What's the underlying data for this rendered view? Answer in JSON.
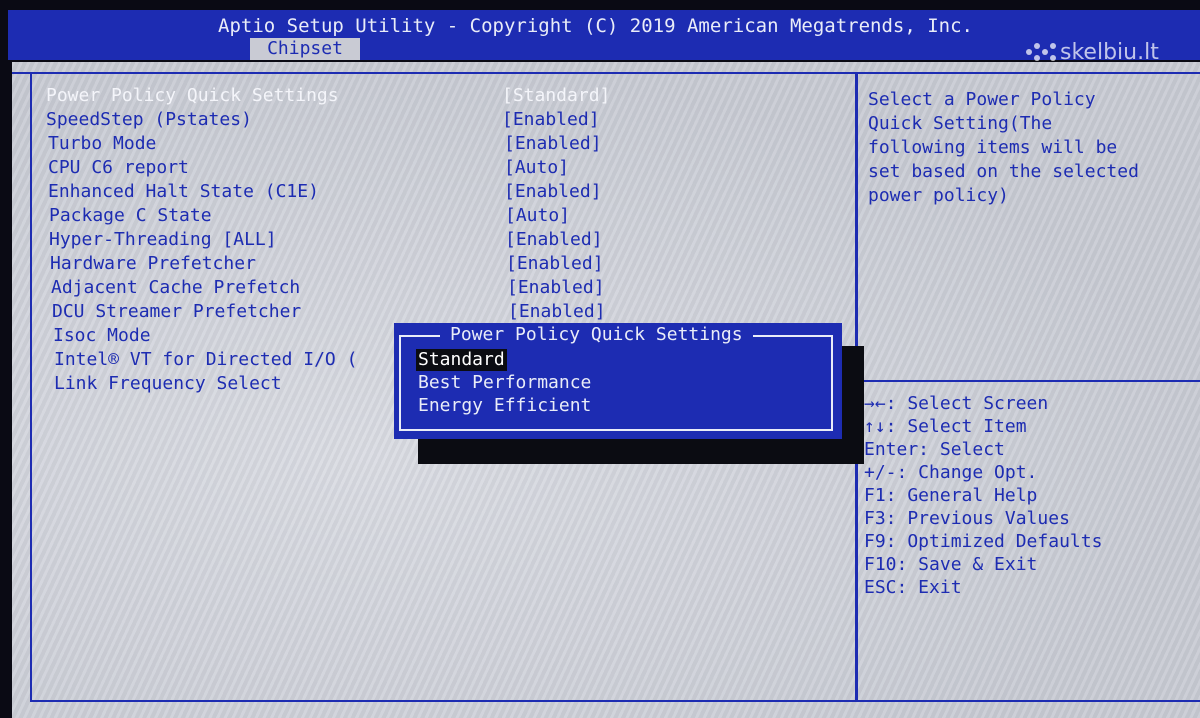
{
  "header": {
    "title": "Aptio Setup Utility - Copyright (C) 2019 American Megatrends, Inc.",
    "active_tab": "Chipset",
    "watermark": "skelbiu.lt"
  },
  "settings": [
    {
      "label": "Power Policy Quick Settings",
      "value": "[Standard]",
      "selected": true
    },
    {
      "label": "SpeedStep (Pstates)",
      "value": "[Enabled]"
    },
    {
      "label": "Turbo Mode",
      "value": "[Enabled]"
    },
    {
      "label": "CPU C6 report",
      "value": "[Auto]"
    },
    {
      "label": "Enhanced Halt State (C1E)",
      "value": "[Enabled]"
    },
    {
      "label": "Package C State",
      "value": "[Auto]"
    },
    {
      "label": "Hyper-Threading [ALL]",
      "value": "[Enabled]"
    },
    {
      "label": "Hardware Prefetcher",
      "value": "[Enabled]"
    },
    {
      "label": "Adjacent Cache Prefetch",
      "value": "[Enabled]"
    },
    {
      "label": "DCU Streamer Prefetcher",
      "value": "[Enabled]"
    },
    {
      "label": "Isoc Mode",
      "value": ""
    },
    {
      "label": "Intel® VT for Directed I/O (",
      "value": ""
    },
    {
      "label": "Link Frequency Select",
      "value": ""
    }
  ],
  "help_text": [
    "Select a Power Policy",
    "Quick Setting(The",
    "following items will be",
    "set based on the selected",
    "power policy)"
  ],
  "key_help": [
    "→←: Select Screen",
    "↑↓: Select Item",
    "Enter: Select",
    "+/-: Change Opt.",
    "F1: General Help",
    "F3: Previous Values",
    "F9: Optimized Defaults",
    "F10: Save & Exit",
    "ESC: Exit"
  ],
  "popup": {
    "title": "Power Policy Quick Settings",
    "options": [
      {
        "label": "Standard",
        "highlighted": true
      },
      {
        "label": "Best Performance"
      },
      {
        "label": "Energy Efficient"
      }
    ]
  },
  "colors": {
    "bios_blue": "#1d2cb2",
    "panel_gray": "#cdd0d8",
    "highlight_text": "#f4f5fa"
  }
}
